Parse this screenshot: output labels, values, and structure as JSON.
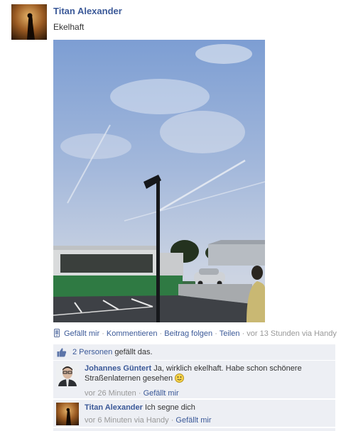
{
  "post": {
    "author": "Titan Alexander",
    "message": "Ekelhaft",
    "actions": {
      "like": "Gefällt mir",
      "comment": "Kommentieren",
      "follow": "Beitrag folgen",
      "share": "Teilen",
      "time": "vor 13 Stunden via Handy",
      "separator": "·"
    }
  },
  "likes": {
    "count_link": "2 Personen",
    "suffix": "gefällt das."
  },
  "comments": [
    {
      "author": "Johannes Güntert",
      "text": "Ja, wirklich ekelhaft. Habe schon schönere Straßenlaternen gesehen",
      "time": "vor 26 Minuten",
      "like": "Gefällt mir"
    },
    {
      "author": "Titan Alexander",
      "text": "Ich segne dich",
      "time": "vor 6 Minuten via Handy",
      "like": "Gefällt mir"
    }
  ],
  "colors": {
    "link": "#3b5998",
    "meta": "#999999",
    "ufi_bg": "#edeff4"
  }
}
